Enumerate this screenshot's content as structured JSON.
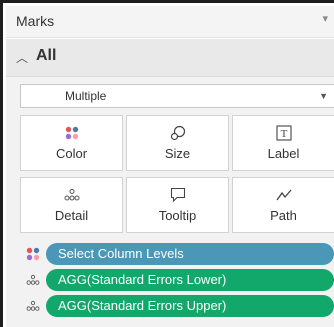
{
  "panel": {
    "title": "Marks",
    "all_label": "All",
    "mark_type": "Multiple"
  },
  "buttons": [
    {
      "label": "Color",
      "icon": "color-dots-icon"
    },
    {
      "label": "Size",
      "icon": "size-icon"
    },
    {
      "label": "Label",
      "icon": "label-icon"
    },
    {
      "label": "Detail",
      "icon": "detail-dots-icon"
    },
    {
      "label": "Tooltip",
      "icon": "tooltip-icon"
    },
    {
      "label": "Path",
      "icon": "path-icon"
    }
  ],
  "pills": [
    {
      "label": "Select Column Levels",
      "icon": "color-dots-icon",
      "color": "#4a97b8"
    },
    {
      "label": "AGG(Standard Errors Lower)",
      "icon": "detail-dots-icon",
      "color": "#13a86b"
    },
    {
      "label": "AGG(Standard Errors Upper)",
      "icon": "detail-dots-icon",
      "color": "#13a86b"
    }
  ],
  "colors": {
    "dimension_pill": "#4a97b8",
    "measure_pill": "#13a86b",
    "dot_red": "#e15759",
    "dot_blue": "#4e79a7",
    "dot_purple": "#9c6ad1",
    "dot_pink": "#ff9da7"
  }
}
